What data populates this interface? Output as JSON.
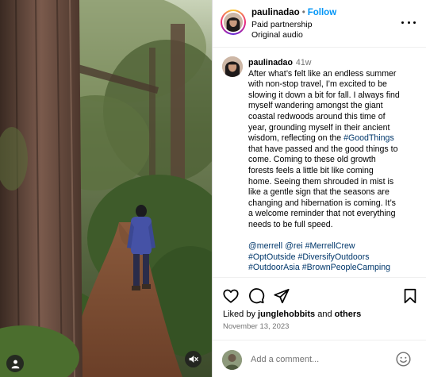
{
  "post": {
    "username": "paulinadao",
    "separator": "•",
    "follow_label": "Follow",
    "partnership_label": "Paid partnership",
    "audio_label": "Original audio"
  },
  "caption": {
    "username": "paulinadao",
    "time": "41w",
    "lines": [
      "After what’s felt like an endless summer",
      "with non-stop travel, I’m excited to be",
      "slowing it down a bit for fall. I always find",
      "myself wandering amongst the giant",
      "coastal redwoods around this time of",
      "year, grounding myself in their ancient",
      "wisdom, reflecting on the",
      "that have passed and the good things to",
      "come. Coming to these old growth",
      "forests feels a little bit like coming",
      "home. Seeing them shrouded in mist is",
      "like a gentle sign that the seasons are",
      "changing and hibernation is coming. It’s",
      "a welcome reminder that not everything",
      "needs to be full speed."
    ],
    "hashtag_inline": "#GoodThings",
    "tags_line1": [
      "@merrell",
      "@rei",
      "#MerrellCrew"
    ],
    "tags_line2": [
      "#OptOutside",
      "#DiversifyOutdoors"
    ],
    "tags_line3": [
      "#OutdoorAsia",
      "#BrownPeopleCamping"
    ]
  },
  "actions": {
    "like_icon": "heart-icon",
    "comment_icon": "comment-icon",
    "share_icon": "paper-plane-icon",
    "save_icon": "bookmark-icon"
  },
  "likes": {
    "prefix": "Liked by",
    "user": "junglehobbits",
    "joiner": "and",
    "others": "others"
  },
  "date": "November 13, 2023",
  "comment": {
    "placeholder": "Add a comment...",
    "emoji_icon": "smiley-icon"
  },
  "colors": {
    "link_blue": "#0095f6",
    "hashtag_blue": "#00376b",
    "muted_gray": "#737373",
    "divider": "#dbdbdb"
  }
}
